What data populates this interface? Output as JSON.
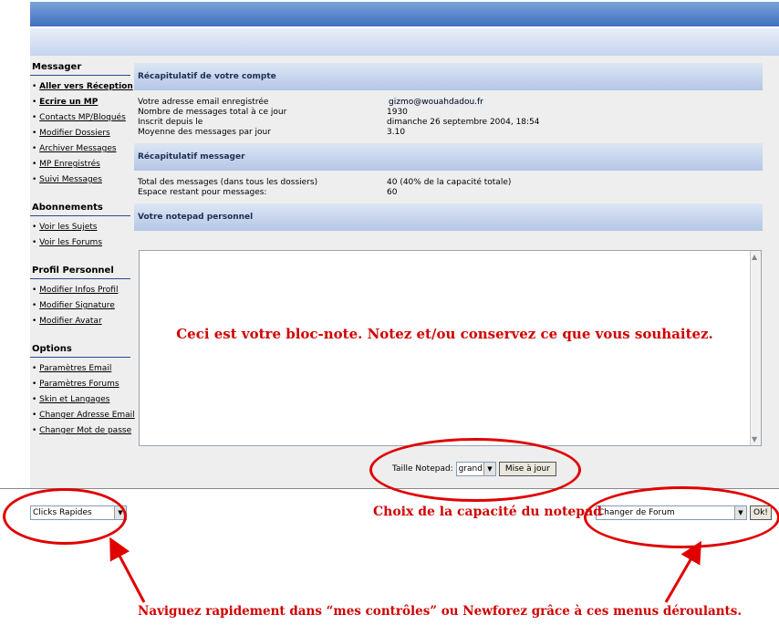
{
  "sidebar": {
    "groups": [
      {
        "title": "Messager",
        "items": [
          "Aller vers Réception",
          "Ecrire un MP",
          "Contacts MP/Bloqués",
          "Modifier Dossiers",
          "Archiver Messages",
          "MP Enregistrés",
          "Suivi Messages"
        ]
      },
      {
        "title": "Abonnements",
        "items": [
          "Voir les Sujets",
          "Voir les Forums"
        ]
      },
      {
        "title": "Profil Personnel",
        "items": [
          "Modifier Infos Profil",
          "Modifier Signature",
          "Modifier Avatar"
        ]
      },
      {
        "title": "Options",
        "items": [
          "Paramètres Email",
          "Paramètres Forums",
          "Skin et Langages",
          "Changer Adresse Email",
          "Changer Mot de passe"
        ]
      }
    ]
  },
  "main": {
    "account_title": "Récapitulatif de votre compte",
    "account_rows": [
      {
        "label": "Votre adresse email enregistrée",
        "value": "gizmo@wouahdadou.fr"
      },
      {
        "label": "Nombre de messages total à ce jour",
        "value": "1930"
      },
      {
        "label": "Inscrit depuis le",
        "value": "dimanche 26 septembre 2004, 18:54"
      },
      {
        "label": "Moyenne des messages par jour",
        "value": "3.10"
      }
    ],
    "message_title": "Récapitulatif messager",
    "message_rows": [
      {
        "label": "Total des messages (dans tous les dossiers)",
        "value": "40 (40% de la capacité totale)"
      },
      {
        "label": "Espace restant pour messages:",
        "value": "60"
      }
    ],
    "notepad_title": "Votre notepad personnel",
    "notepad_text": "Ceci est votre bloc-note. Notez et/ou conservez ce que vous souhaitez."
  },
  "notepad_controls": {
    "size_label": "Taille Notepad:",
    "size_value": "grand",
    "update_button": "Mise à jour"
  },
  "footer": {
    "quick_clicks": "Clicks Rapides",
    "forum_select": "Changer de Forum",
    "ok_button": "Ok!"
  },
  "annotations": {
    "capacity": "Choix de la capacité du notepad",
    "navigate": "Naviguez rapidement dans “mes contrôles” ou Newforez grâce à ces menus déroulants."
  },
  "colors": {
    "annotation": "#d10000",
    "header_blue": "#3f6fbf",
    "section_blue": "#b4c6e6"
  }
}
